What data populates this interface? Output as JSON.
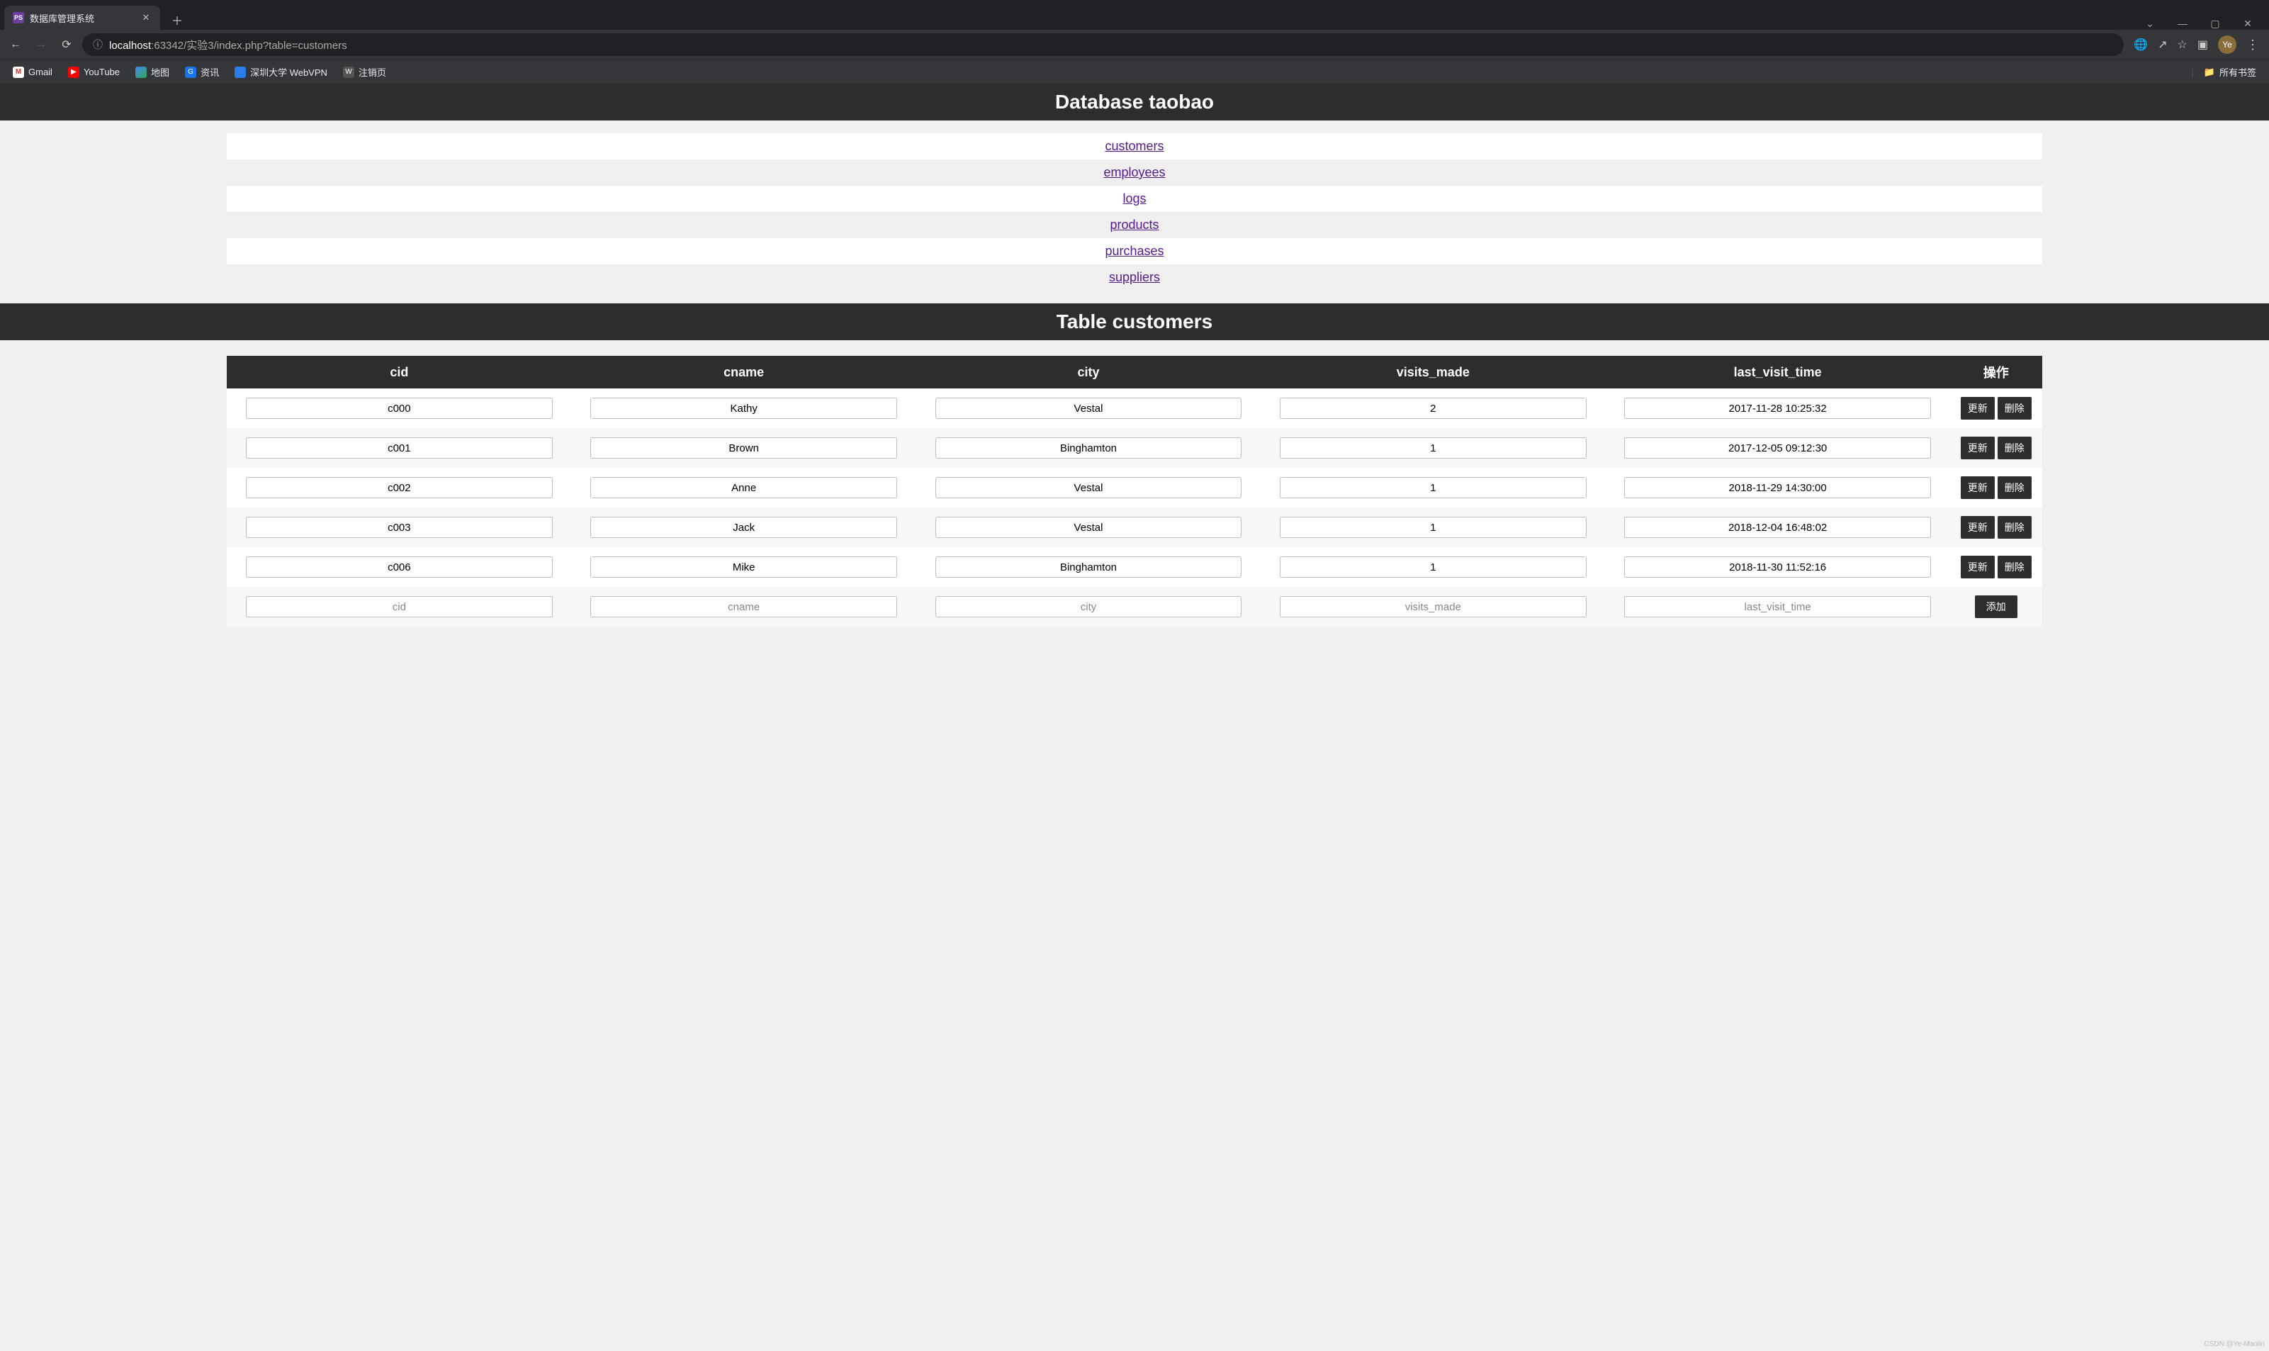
{
  "browser": {
    "tab_title": "数据库管理系统",
    "url_host": "localhost",
    "url_port": ":63342",
    "url_path": "/实验3/index.php?table=customers",
    "avatar_initials": "Ye",
    "all_bookmarks_label": "所有书签",
    "bookmarks": [
      {
        "label": "Gmail",
        "icon_class": "ico-gmail",
        "icon_text": "M"
      },
      {
        "label": "YouTube",
        "icon_class": "ico-yt",
        "icon_text": "▶"
      },
      {
        "label": "地图",
        "icon_class": "ico-map",
        "icon_text": ""
      },
      {
        "label": "资讯",
        "icon_class": "ico-news",
        "icon_text": "G"
      },
      {
        "label": "深圳大学 WebVPN",
        "icon_class": "ico-vpn",
        "icon_text": ""
      },
      {
        "label": "注销页",
        "icon_class": "ico-wp",
        "icon_text": "W"
      }
    ]
  },
  "page": {
    "db_heading": "Database taobao",
    "table_heading": "Table customers",
    "table_links": [
      "customers",
      "employees",
      "logs",
      "products",
      "purchases",
      "suppliers"
    ],
    "columns": [
      "cid",
      "cname",
      "city",
      "visits_made",
      "last_visit_time"
    ],
    "op_header": "操作",
    "rows": [
      {
        "cid": "c000",
        "cname": "Kathy",
        "city": "Vestal",
        "visits_made": "2",
        "last_visit_time": "2017-11-28 10:25:32"
      },
      {
        "cid": "c001",
        "cname": "Brown",
        "city": "Binghamton",
        "visits_made": "1",
        "last_visit_time": "2017-12-05 09:12:30"
      },
      {
        "cid": "c002",
        "cname": "Anne",
        "city": "Vestal",
        "visits_made": "1",
        "last_visit_time": "2018-11-29 14:30:00"
      },
      {
        "cid": "c003",
        "cname": "Jack",
        "city": "Vestal",
        "visits_made": "1",
        "last_visit_time": "2018-12-04 16:48:02"
      },
      {
        "cid": "c006",
        "cname": "Mike",
        "city": "Binghamton",
        "visits_made": "1",
        "last_visit_time": "2018-11-30 11:52:16"
      }
    ],
    "placeholders": {
      "cid": "cid",
      "cname": "cname",
      "city": "city",
      "visits_made": "visits_made",
      "last_visit_time": "last_visit_time"
    },
    "buttons": {
      "update": "更新",
      "delete": "删除",
      "add": "添加"
    }
  },
  "watermark": "CSDN @Ye-Maolin"
}
